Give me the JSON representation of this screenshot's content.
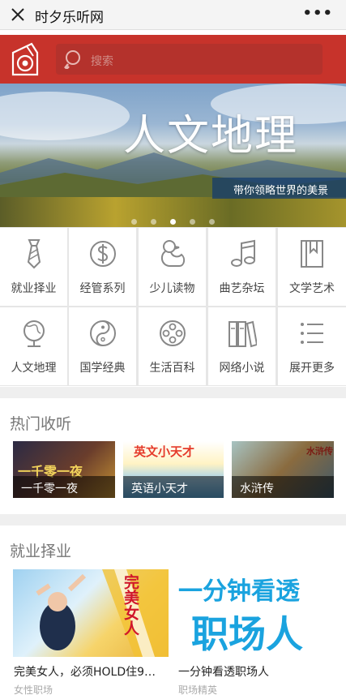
{
  "titlebar": {
    "title": "时夕乐听网",
    "close_icon": "close-icon",
    "more_label": "•••"
  },
  "header": {
    "search_placeholder": "搜索",
    "accent": "#c7332b"
  },
  "banner": {
    "headline": "人文地理",
    "subtitle": "带你领略世界的美景",
    "dots": 5,
    "active_dot": 2
  },
  "categories": [
    {
      "label": "就业择业",
      "icon": "tie-icon"
    },
    {
      "label": "经管系列",
      "icon": "dollar-coin-icon"
    },
    {
      "label": "少儿读物",
      "icon": "duck-icon"
    },
    {
      "label": "曲艺杂坛",
      "icon": "music-note-icon"
    },
    {
      "label": "文学艺术",
      "icon": "bookmark-book-icon"
    },
    {
      "label": "人文地理",
      "icon": "globe-icon"
    },
    {
      "label": "国学经典",
      "icon": "yin-yang-icon"
    },
    {
      "label": "生活百科",
      "icon": "film-reel-icon"
    },
    {
      "label": "网络小说",
      "icon": "binders-icon"
    },
    {
      "label": "展开更多",
      "icon": "list-icon"
    }
  ],
  "hot": {
    "title": "热门收听",
    "items": [
      {
        "label": "一千零一夜",
        "cover_text": "一千零一夜"
      },
      {
        "label": "英语小天才",
        "cover_text": "英文小天才"
      },
      {
        "label": "水浒传",
        "cover_text": "水浒传"
      }
    ]
  },
  "employment": {
    "title": "就业择业",
    "books": [
      {
        "title": "完美女人，必须HOLD住9…",
        "tag": "女性职场",
        "cover_text": "完美女人"
      },
      {
        "title": "一分钟看透职场人",
        "tag": "职场精英",
        "cover_line1": "一分钟看透",
        "cover_line2": "职场人"
      }
    ]
  }
}
